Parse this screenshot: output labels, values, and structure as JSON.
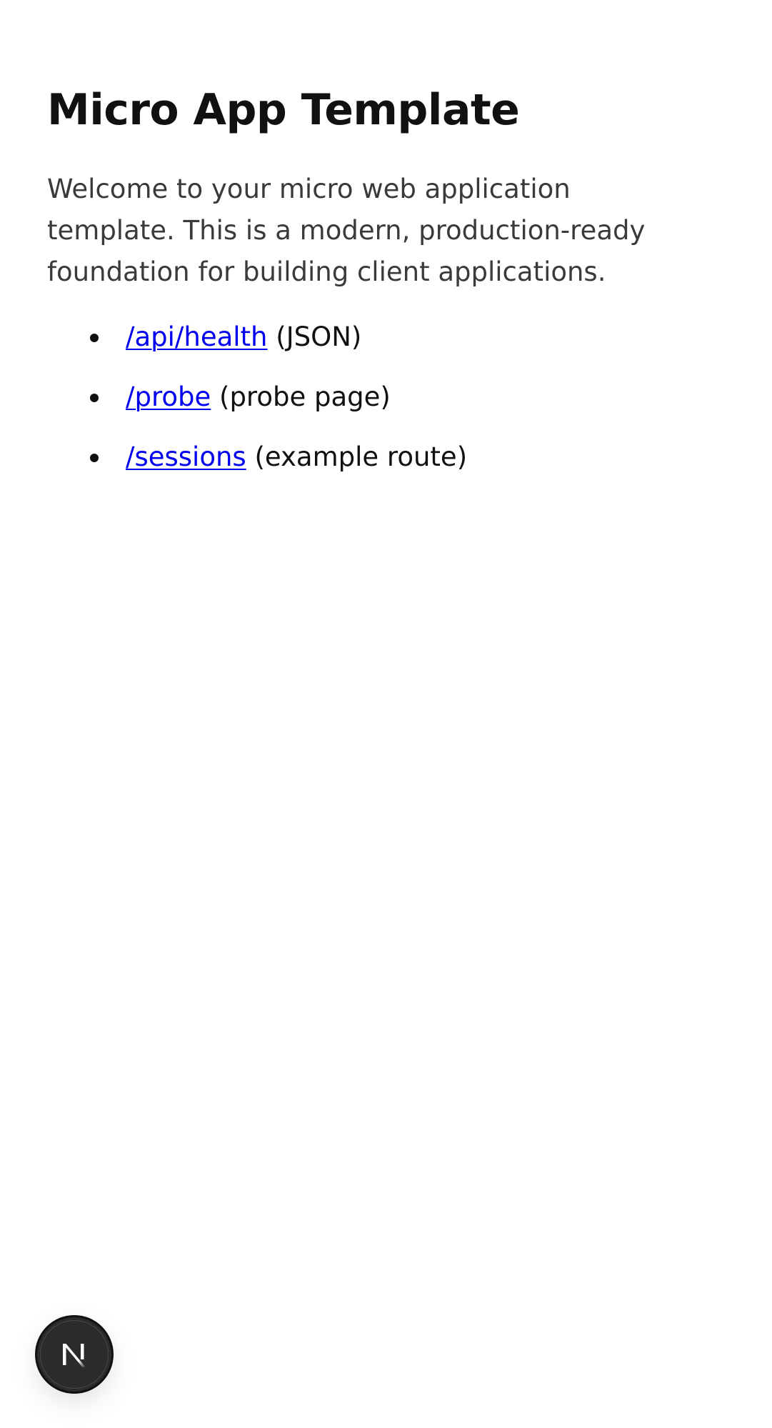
{
  "page": {
    "title": "Micro App Template",
    "intro": "Welcome to your micro web application template. This is a modern, production-ready foundation for building client applications."
  },
  "links": [
    {
      "label": "/api/health",
      "description": " (JSON)"
    },
    {
      "label": "/probe",
      "description": " (probe page)"
    },
    {
      "label": "/sessions",
      "description": " (example route)"
    }
  ],
  "dev_badge": {
    "icon": "n-logo-icon"
  },
  "colors": {
    "link": "#0000ee",
    "text": "#111111",
    "intro_text": "#3a3a3a",
    "badge_bg": "#2b2b2b"
  }
}
